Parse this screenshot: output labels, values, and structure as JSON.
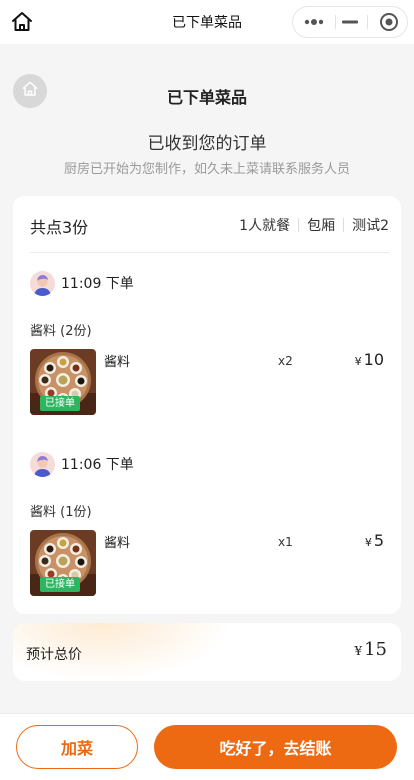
{
  "navbar": {
    "title": "已下单菜品"
  },
  "header": {
    "title": "已下单菜品",
    "received": "已收到您的订单",
    "hint": "厨房已开始为您制作，如久未上菜请联系服务人员"
  },
  "summary": {
    "total": "共点3份",
    "tags": [
      "1人就餐",
      "包厢",
      "测试2"
    ]
  },
  "batches": [
    {
      "time": "11:09 下单",
      "group_label": "酱料 (2份)",
      "item": {
        "name": "酱料",
        "qty": "x2",
        "currency": "¥",
        "price": "10",
        "status": "已接单"
      }
    },
    {
      "time": "11:06 下单",
      "group_label": "酱料 (1份)",
      "item": {
        "name": "酱料",
        "qty": "x1",
        "currency": "¥",
        "price": "5",
        "status": "已接单"
      }
    }
  ],
  "total": {
    "label": "预计总价",
    "currency": "¥",
    "value": "15"
  },
  "actions": {
    "add": "加菜",
    "pay": "吃好了，去结账"
  },
  "colors": {
    "accent": "#ee6a12",
    "badge": "#2db661"
  },
  "icons": {
    "nav_home": "home-icon",
    "more": "more-dots-icon",
    "minimize": "minimize-icon",
    "close": "target-close-icon",
    "back_home": "home-icon",
    "avatar": "avatar-icon"
  }
}
